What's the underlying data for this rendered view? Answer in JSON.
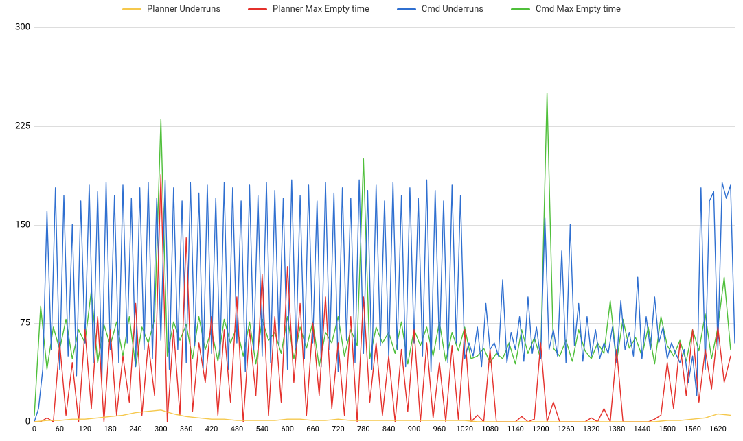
{
  "_colors": {
    "planner_underruns_bg": "background:#f5c84c",
    "planner_max_empty_bg": "background:#e4302b",
    "cmd_underruns_bg": "background:#2f6fd0",
    "cmd_max_empty_bg": "background:#4fbf3a"
  },
  "chart_data": {
    "type": "line",
    "title": "",
    "xlabel": "",
    "ylabel": "",
    "xlim": [
      0,
      1660
    ],
    "ylim": [
      0,
      300
    ],
    "yticks": [
      0,
      75,
      150,
      225,
      300
    ],
    "xticks": [
      0,
      60,
      120,
      180,
      240,
      300,
      360,
      420,
      480,
      540,
      600,
      660,
      720,
      780,
      840,
      900,
      960,
      1020,
      1080,
      1140,
      1200,
      1260,
      1320,
      1380,
      1440,
      1500,
      1560,
      1620
    ],
    "series": [
      {
        "name": "Planner Underruns",
        "color": "#f5c84c",
        "x": [
          0,
          30,
          60,
          90,
          120,
          150,
          180,
          210,
          240,
          270,
          300,
          330,
          360,
          390,
          420,
          450,
          480,
          510,
          540,
          570,
          600,
          630,
          660,
          690,
          720,
          750,
          780,
          810,
          840,
          870,
          900,
          930,
          960,
          990,
          1020,
          1050,
          1080,
          1110,
          1140,
          1170,
          1200,
          1230,
          1260,
          1290,
          1320,
          1350,
          1380,
          1410,
          1440,
          1470,
          1500,
          1530,
          1560,
          1590,
          1620,
          1650
        ],
        "values": [
          0,
          1,
          1,
          2,
          2,
          3,
          4,
          5,
          7,
          8,
          9,
          6,
          4,
          3,
          2,
          2,
          1,
          1,
          1,
          1,
          2,
          2,
          1,
          1,
          2,
          1,
          1,
          1,
          1,
          1,
          1,
          1,
          1,
          1,
          1,
          0,
          0,
          0,
          0,
          0,
          0,
          0,
          0,
          0,
          0,
          0,
          0,
          0,
          0,
          0,
          1,
          1,
          2,
          3,
          6,
          5
        ]
      },
      {
        "name": "Planner Max Empty time",
        "color": "#e4302b",
        "x": [
          0,
          15,
          30,
          45,
          60,
          75,
          90,
          105,
          120,
          135,
          150,
          165,
          180,
          195,
          210,
          225,
          240,
          255,
          270,
          285,
          300,
          315,
          330,
          345,
          360,
          375,
          390,
          405,
          420,
          435,
          450,
          465,
          480,
          495,
          510,
          525,
          540,
          555,
          570,
          585,
          600,
          615,
          630,
          645,
          660,
          675,
          690,
          705,
          720,
          735,
          750,
          765,
          780,
          795,
          810,
          825,
          840,
          855,
          870,
          885,
          900,
          915,
          930,
          945,
          960,
          975,
          990,
          1005,
          1020,
          1035,
          1050,
          1065,
          1080,
          1095,
          1110,
          1125,
          1140,
          1155,
          1170,
          1185,
          1200,
          1215,
          1230,
          1245,
          1260,
          1275,
          1290,
          1305,
          1320,
          1335,
          1350,
          1365,
          1380,
          1395,
          1410,
          1425,
          1440,
          1455,
          1470,
          1485,
          1500,
          1515,
          1530,
          1545,
          1560,
          1575,
          1590,
          1605,
          1620,
          1635,
          1650
        ],
        "values": [
          0,
          0,
          3,
          0,
          60,
          5,
          45,
          0,
          70,
          10,
          80,
          0,
          70,
          5,
          50,
          15,
          90,
          5,
          60,
          20,
          188,
          0,
          70,
          5,
          140,
          8,
          60,
          30,
          80,
          5,
          70,
          15,
          95,
          0,
          70,
          20,
          112,
          5,
          80,
          15,
          118,
          30,
          90,
          5,
          75,
          20,
          95,
          10,
          60,
          5,
          80,
          0,
          95,
          15,
          60,
          5,
          50,
          0,
          55,
          8,
          70,
          0,
          60,
          3,
          45,
          0,
          58,
          2,
          70,
          0,
          5,
          0,
          55,
          0,
          0,
          0,
          0,
          4,
          0,
          2,
          60,
          0,
          15,
          0,
          0,
          0,
          0,
          0,
          3,
          0,
          10,
          0,
          55,
          0,
          0,
          0,
          0,
          0,
          2,
          5,
          45,
          10,
          60,
          20,
          70,
          15,
          55,
          25,
          72,
          30,
          50
        ]
      },
      {
        "name": "Cmd Underruns",
        "color": "#2f6fd0",
        "x": [
          0,
          10,
          20,
          30,
          40,
          50,
          60,
          70,
          80,
          90,
          100,
          110,
          120,
          130,
          140,
          150,
          160,
          170,
          180,
          190,
          200,
          210,
          220,
          230,
          240,
          250,
          260,
          270,
          280,
          290,
          300,
          310,
          320,
          330,
          340,
          350,
          360,
          370,
          380,
          390,
          400,
          410,
          420,
          430,
          440,
          450,
          460,
          470,
          480,
          490,
          500,
          510,
          520,
          530,
          540,
          550,
          560,
          570,
          580,
          590,
          600,
          610,
          620,
          630,
          640,
          650,
          660,
          670,
          680,
          690,
          700,
          710,
          720,
          730,
          740,
          750,
          760,
          770,
          780,
          790,
          800,
          810,
          820,
          830,
          840,
          850,
          860,
          870,
          880,
          890,
          900,
          910,
          920,
          930,
          940,
          950,
          960,
          970,
          980,
          990,
          1000,
          1010,
          1020,
          1030,
          1040,
          1050,
          1060,
          1070,
          1080,
          1090,
          1100,
          1110,
          1120,
          1130,
          1140,
          1150,
          1160,
          1170,
          1180,
          1190,
          1200,
          1210,
          1220,
          1230,
          1240,
          1250,
          1260,
          1270,
          1280,
          1290,
          1300,
          1310,
          1320,
          1330,
          1340,
          1350,
          1360,
          1370,
          1380,
          1390,
          1400,
          1410,
          1420,
          1430,
          1440,
          1450,
          1460,
          1470,
          1480,
          1490,
          1500,
          1510,
          1520,
          1530,
          1540,
          1550,
          1560,
          1570,
          1580,
          1590,
          1600,
          1610,
          1620,
          1630,
          1640,
          1650,
          1660
        ],
        "values": [
          0,
          10,
          40,
          160,
          55,
          178,
          40,
          172,
          50,
          150,
          35,
          168,
          60,
          180,
          45,
          175,
          30,
          182,
          55,
          172,
          45,
          180,
          60,
          170,
          42,
          178,
          55,
          182,
          48,
          170,
          62,
          184,
          40,
          178,
          55,
          168,
          45,
          182,
          58,
          174,
          38,
          180,
          52,
          170,
          48,
          182,
          40,
          178,
          60,
          168,
          38,
          180,
          55,
          172,
          50,
          182,
          45,
          176,
          58,
          170,
          40,
          184,
          55,
          172,
          48,
          180,
          60,
          168,
          42,
          182,
          55,
          174,
          38,
          178,
          62,
          170,
          45,
          184,
          52,
          176,
          40,
          180,
          58,
          168,
          48,
          182,
          55,
          172,
          42,
          178,
          60,
          170,
          50,
          184,
          38,
          176,
          55,
          168,
          45,
          180,
          60,
          172,
          48,
          60,
          50,
          72,
          42,
          90,
          55,
          60,
          50,
          108,
          45,
          68,
          55,
          80,
          46,
          95,
          52,
          72,
          48,
          155,
          55,
          70,
          50,
          130,
          45,
          150,
          58,
          90,
          46,
          80,
          50,
          70,
          48,
          60,
          52,
          72,
          45,
          92,
          55,
          68,
          50,
          110,
          48,
          80,
          55,
          95,
          60,
          72,
          48,
          60,
          52,
          45,
          55,
          30,
          50,
          20,
          178,
          40,
          168,
          175,
          55,
          182,
          170,
          180,
          60
        ]
      },
      {
        "name": "Cmd Max Empty time",
        "color": "#4fbf3a",
        "x": [
          0,
          15,
          30,
          45,
          60,
          75,
          90,
          105,
          120,
          135,
          150,
          165,
          180,
          195,
          210,
          225,
          240,
          255,
          270,
          285,
          300,
          315,
          330,
          345,
          360,
          375,
          390,
          405,
          420,
          435,
          450,
          465,
          480,
          495,
          510,
          525,
          540,
          555,
          570,
          585,
          600,
          615,
          630,
          645,
          660,
          675,
          690,
          705,
          720,
          735,
          750,
          765,
          780,
          795,
          810,
          825,
          840,
          855,
          870,
          885,
          900,
          915,
          930,
          945,
          960,
          975,
          990,
          1005,
          1020,
          1035,
          1050,
          1065,
          1080,
          1095,
          1110,
          1125,
          1140,
          1155,
          1170,
          1185,
          1200,
          1215,
          1230,
          1245,
          1260,
          1275,
          1290,
          1305,
          1320,
          1335,
          1350,
          1365,
          1380,
          1395,
          1410,
          1425,
          1440,
          1455,
          1470,
          1485,
          1500,
          1515,
          1530,
          1545,
          1560,
          1575,
          1590,
          1605,
          1620,
          1635,
          1650
        ],
        "values": [
          5,
          88,
          40,
          72,
          55,
          78,
          48,
          70,
          60,
          100,
          45,
          74,
          58,
          76,
          50,
          80,
          42,
          72,
          60,
          78,
          230,
          50,
          76,
          62,
          74,
          48,
          80,
          55,
          70,
          46,
          78,
          60,
          72,
          50,
          76,
          44,
          78,
          62,
          68,
          52,
          80,
          48,
          72,
          56,
          76,
          42,
          68,
          60,
          80,
          50,
          70,
          58,
          200,
          48,
          72,
          60,
          68,
          52,
          76,
          44,
          70,
          58,
          72,
          50,
          76,
          46,
          68,
          54,
          72,
          48,
          50,
          56,
          45,
          52,
          48,
          60,
          44,
          70,
          52,
          64,
          48,
          250,
          56,
          50,
          62,
          46,
          70,
          54,
          48,
          60,
          52,
          92,
          46,
          78,
          56,
          64,
          50,
          72,
          44,
          80,
          58,
          50,
          62,
          46,
          70,
          54,
          82,
          48,
          72,
          110,
          55
        ]
      }
    ]
  }
}
